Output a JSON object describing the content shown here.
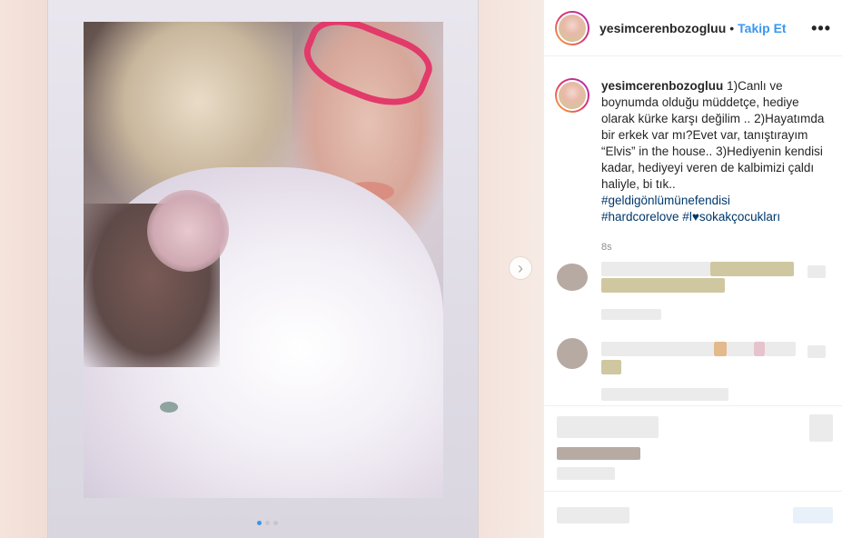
{
  "post": {
    "username": "yesimcerenbozogluu",
    "separator": "•",
    "follow_label": "Takip Et",
    "more_label": "•••",
    "caption": {
      "username": "yesimcerenbozogluu",
      "line1": "1)Canlı ve boynumda olduğu müddetçe, hediye olarak kürke karşı değilim ..",
      "line2": "2)Hayatımda bir erkek var mı?Evet var, tanıştırayım “Elvis” in the house..",
      "line3": "3)Hediyenin kendisi kadar, hediyeyi veren de kalbimizi çaldı haliyle, bi tık..",
      "hashtag1": "#geldigönlümünefendisi",
      "hashtag2": "#hardcorelove #l♥sokakçocukları"
    },
    "timestamp": "8s"
  },
  "carousel": {
    "next_label": "›",
    "dot_count": 3,
    "active_dot": 0
  },
  "colors": {
    "accent": "#3897f0",
    "hashtag": "#00376b",
    "glasses": "#e23a6a"
  }
}
